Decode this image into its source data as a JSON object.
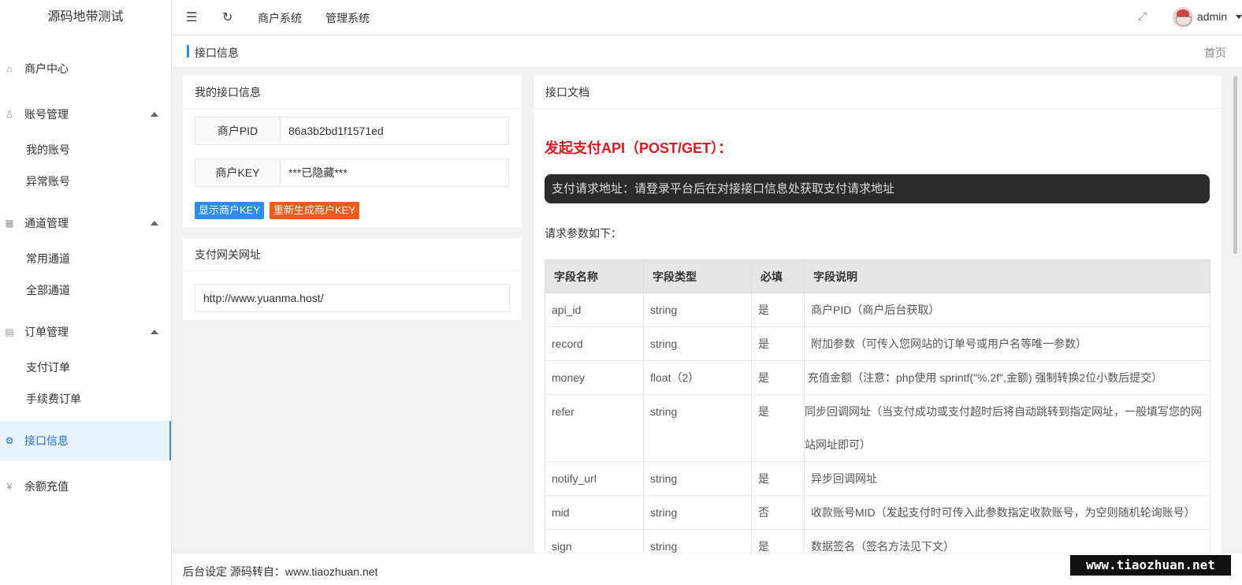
{
  "sidebar": {
    "logo": "源码地带测试",
    "merchant_center": "商户中心",
    "account_mgmt": "账号管理",
    "my_account": "我的账号",
    "abnormal_account": "异常账号",
    "channel_mgmt": "通道管理",
    "common_channel": "常用通道",
    "all_channel": "全部通道",
    "order_mgmt": "订单管理",
    "pay_order": "支付订单",
    "fee_order": "手续费订单",
    "api_info": "接口信息",
    "balance_recharge": "余额充值"
  },
  "header": {
    "merchant_system": "商户系统",
    "admin_system": "管理系统",
    "user": "admin"
  },
  "breadcrumb": {
    "title": "接口信息",
    "home": "首页"
  },
  "my_api": {
    "title": "我的接口信息",
    "pid_label": "商户PID",
    "pid_value": "86a3b2bd1f1571ed",
    "key_label": "商户KEY",
    "key_value": "***已隐藏***",
    "show_key_btn": "显示商户KEY",
    "regen_key_btn": "重新生成商户KEY"
  },
  "gateway": {
    "title": "支付网关网址",
    "url": "http://www.yuanma.host/"
  },
  "doc": {
    "title": "接口文档",
    "api_title": "发起支付API（POST/GET）：",
    "request_url": "支付请求地址：请登录平台后在对接接口信息处获取支付请求地址",
    "params_intro": "请求参数如下：",
    "columns": [
      "字段名称",
      "字段类型",
      "必填",
      "字段说明"
    ],
    "rows": [
      {
        "name": "api_id",
        "type": "string",
        "required": "是",
        "desc": "商户PID（商户后台获取）"
      },
      {
        "name": "record",
        "type": "string",
        "required": "是",
        "desc": "附加参数（可传入您网站的订单号或用户名等唯一参数）"
      },
      {
        "name": "money",
        "type": "float（2）",
        "required": "是",
        "desc": "充值金额（注意：php使用 sprintf(\"%.2f\",金额) 强制转换2位小数后提交）"
      },
      {
        "name": "refer",
        "type": "string",
        "required": "是",
        "desc": "同步回调网址（当支付成功或支付超时后将自动跳转到指定网址，一般填写您的网站网址即可）"
      },
      {
        "name": "notify_url",
        "type": "string",
        "required": "是",
        "desc": "异步回调网址"
      },
      {
        "name": "mid",
        "type": "string",
        "required": "否",
        "desc": "收款账号MID（发起支付时可传入此参数指定收款账号，为空则随机轮询账号）"
      },
      {
        "name": "sign",
        "type": "string",
        "required": "是",
        "desc": "数据签名（签名方法见下文）"
      }
    ]
  },
  "footer": {
    "text": "后台设定 源码转自：www.tiaozhuan.net"
  },
  "watermark": "www.tiaozhuan.net"
}
